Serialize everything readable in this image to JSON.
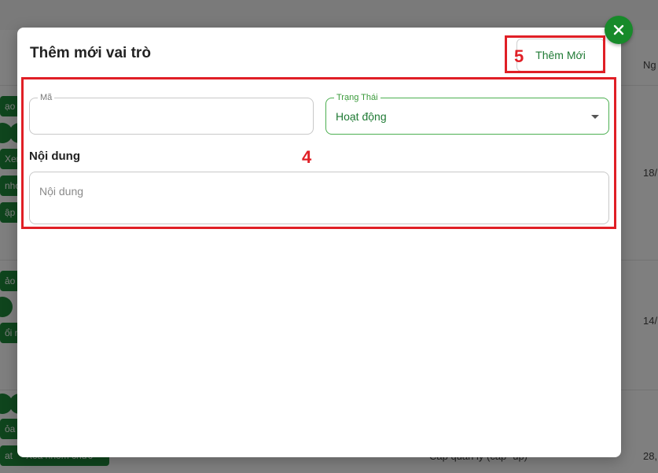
{
  "modal": {
    "title": "Thêm mới vai trò",
    "add_button_label": "Thêm Mới"
  },
  "annotations": {
    "form_region_number": "4",
    "add_button_number": "5"
  },
  "form": {
    "code_label": "Mã",
    "code_value": "",
    "status_label": "Trạng Thái",
    "status_value": "Hoạt động",
    "content_section_label": "Nội dung",
    "content_placeholder": "Nội dung"
  },
  "background": {
    "column_header_partial": "Ng",
    "chips": [
      "ạo t",
      "Xem",
      "nhó",
      "ập n",
      "ảo c",
      "ổi m",
      "ỏa m",
      "at",
      "Xóa nhóm chức"
    ],
    "dates_partial": [
      "18/",
      "14/",
      "28,"
    ],
    "row_text_partial": "Cấp quản lý (cấp -up)"
  },
  "colors": {
    "accent_green": "#178a2a",
    "annotation_red": "#e01f26"
  },
  "icons": {
    "close": "close-icon",
    "dropdown": "caret-down-icon"
  }
}
